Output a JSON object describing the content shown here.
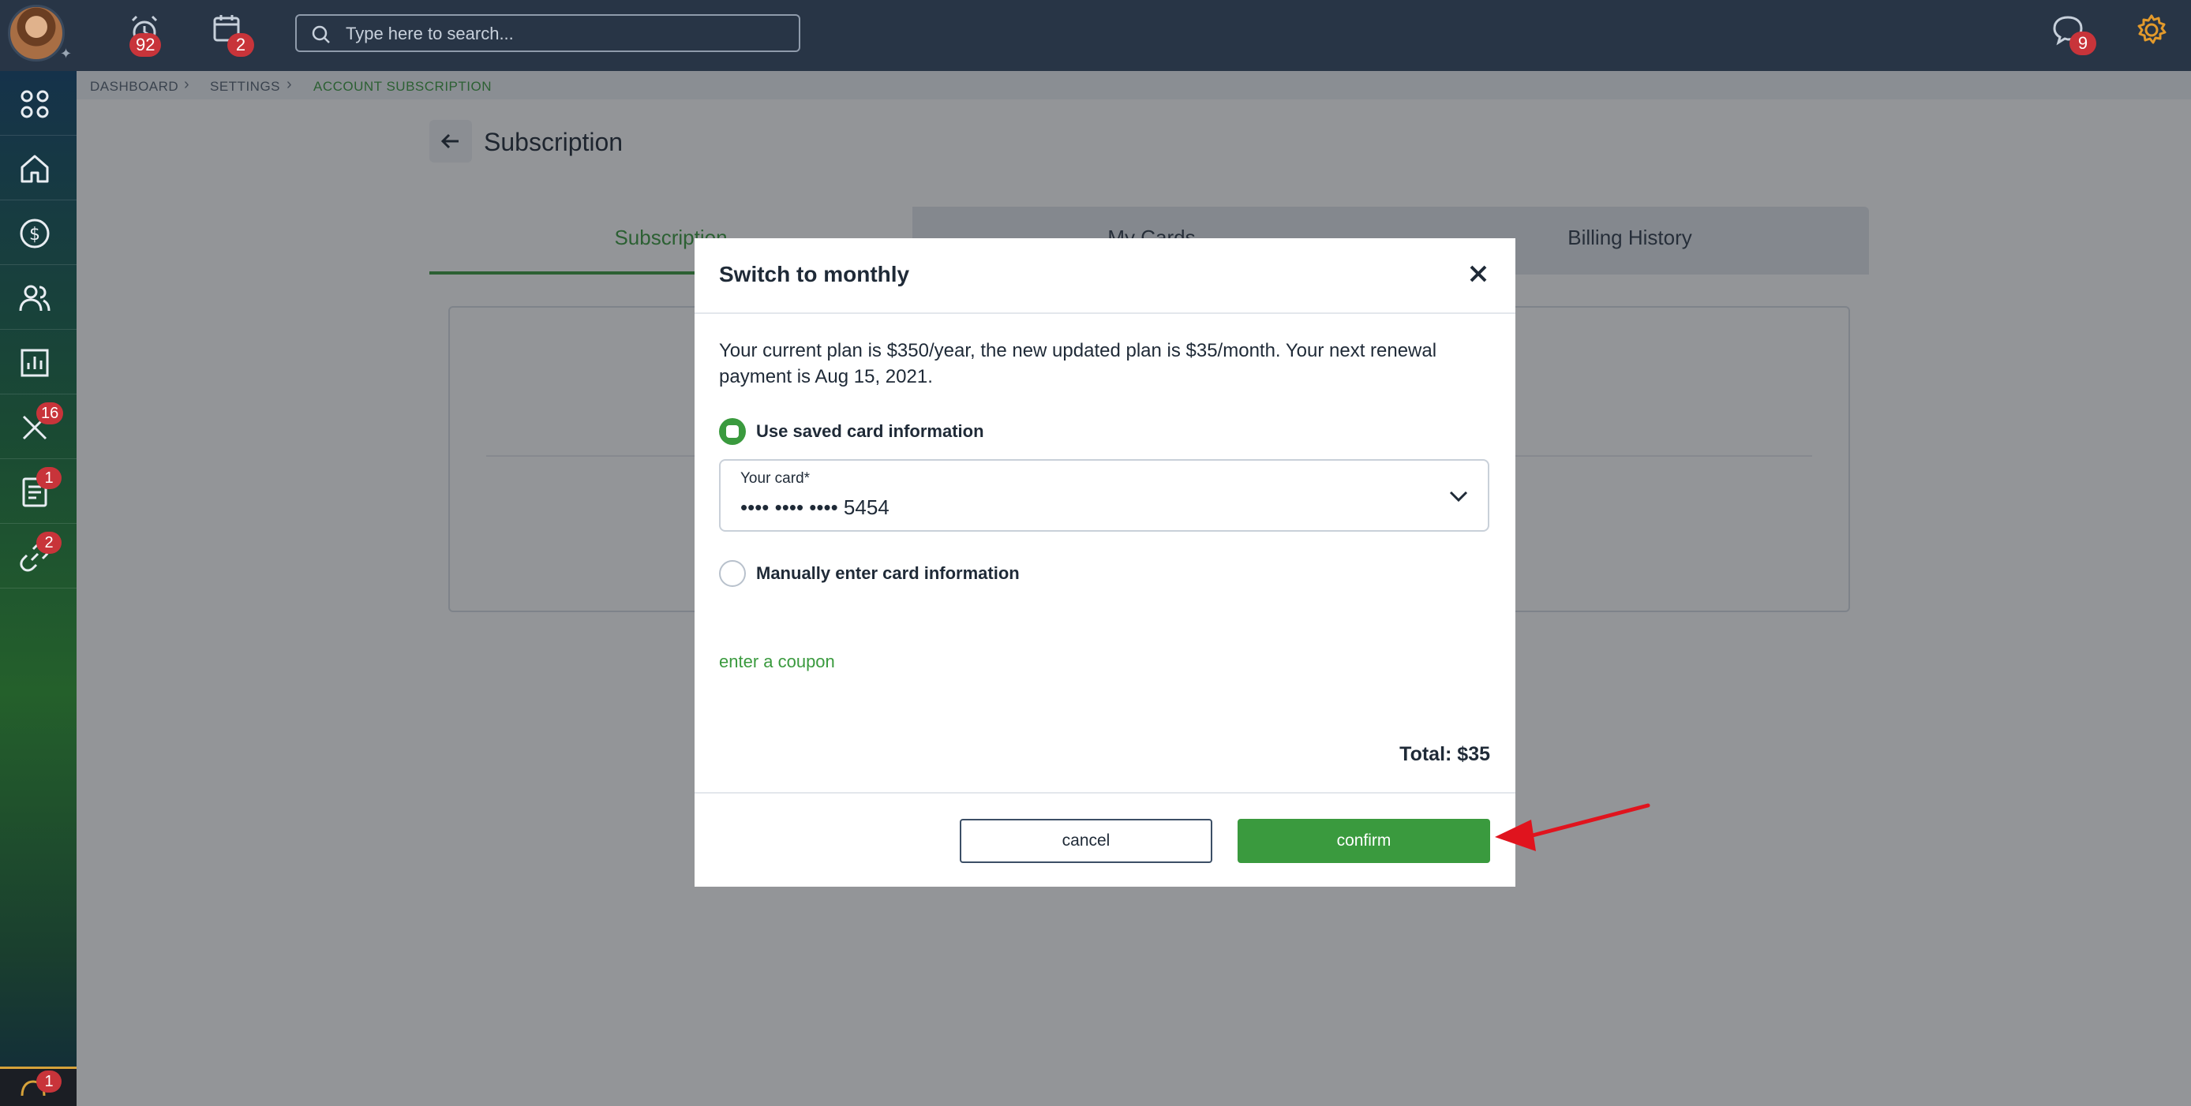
{
  "topbar": {
    "alerts_badge": "92",
    "calendar_badge": "2",
    "search_placeholder": "Type here to search...",
    "messages_badge": "9"
  },
  "sidebar": {
    "tools_badge": "16",
    "documents_badge": "1",
    "links_badge": "2",
    "support_badge": "1"
  },
  "breadcrumb": [
    "DASHBOARD",
    "SETTINGS",
    "ACCOUNT SUBSCRIPTION"
  ],
  "page": {
    "title": "Subscription",
    "tabs": [
      "Subscription",
      "My Cards",
      "Billing History"
    ]
  },
  "modal": {
    "title": "Switch to monthly",
    "description": "Your current plan is $350/year, the new updated plan is $35/month. Your next renewal payment is Aug 15, 2021.",
    "option_saved": "Use saved card information",
    "card_label": "Your card*",
    "card_value": "•••• •••• •••• 5454",
    "option_manual": "Manually enter card information",
    "coupon_link": "enter a coupon",
    "total": "Total: $35",
    "cancel_label": "cancel",
    "confirm_label": "confirm"
  },
  "colors": {
    "accent_green": "#3a9a3e",
    "topbar": "#283546",
    "badge_red": "#c8343a",
    "annotation_arrow": "#e0141e"
  }
}
